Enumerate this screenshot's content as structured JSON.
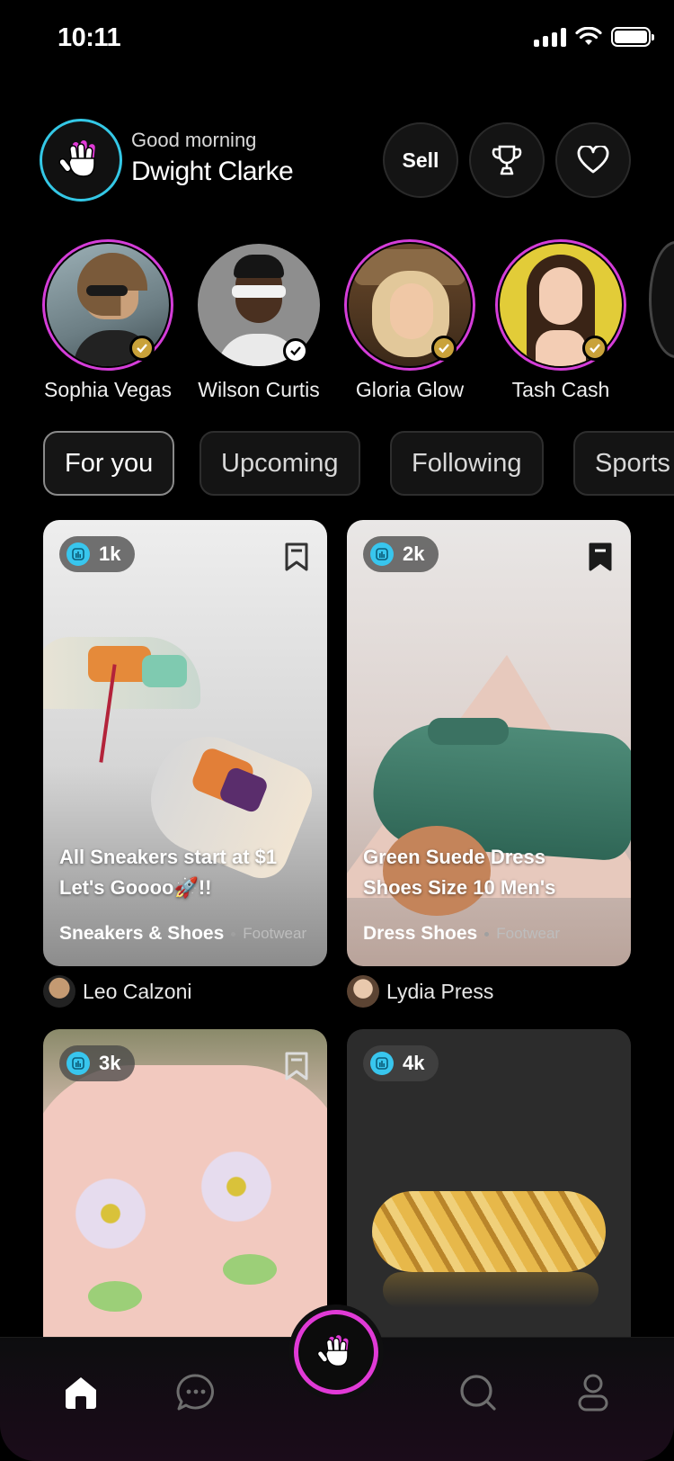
{
  "status_bar": {
    "time": "10:11"
  },
  "header": {
    "greeting": "Good morning",
    "user_name": "Dwight Clarke",
    "sell_label": "Sell"
  },
  "stories": [
    {
      "name": "Sophia Vegas",
      "live": true,
      "verified_color": "#c9a23a"
    },
    {
      "name": "Wilson Curtis",
      "live": false,
      "verified_color": "#ffffff"
    },
    {
      "name": "Gloria Glow",
      "live": true,
      "verified_color": "#c9a23a"
    },
    {
      "name": "Tash Cash",
      "live": true,
      "verified_color": "#c9a23a"
    }
  ],
  "tabs": [
    {
      "label": "For you",
      "active": true
    },
    {
      "label": "Upcoming",
      "active": false
    },
    {
      "label": "Following",
      "active": false
    },
    {
      "label": "Sports",
      "active": false
    }
  ],
  "cards": [
    {
      "viewers": "1k",
      "title_line1": "All Sneakers start at $1",
      "title_line2": "Let's Goooo🚀!!",
      "category": "Sneakers & Shoes",
      "subcategory": "Footwear",
      "seller": "Leo Calzoni",
      "bookmarked": false
    },
    {
      "viewers": "2k",
      "title_line1": "Green Suede Dress",
      "title_line2": "Shoes Size 10 Men's",
      "category": "Dress Shoes",
      "subcategory": "Footwear",
      "seller": "Lydia Press",
      "bookmarked": true
    },
    {
      "viewers": "3k",
      "bookmarked": false
    },
    {
      "viewers": "4k"
    }
  ],
  "nav": {
    "items": [
      "home-icon",
      "chat-icon",
      "live-hand-icon",
      "search-icon",
      "profile-icon"
    ],
    "accent": "#e03ad6"
  },
  "colors": {
    "live_ring": "#d43dd8",
    "viewer_dot": "#38c6ee",
    "avatar_ring": "#34c8e6"
  }
}
